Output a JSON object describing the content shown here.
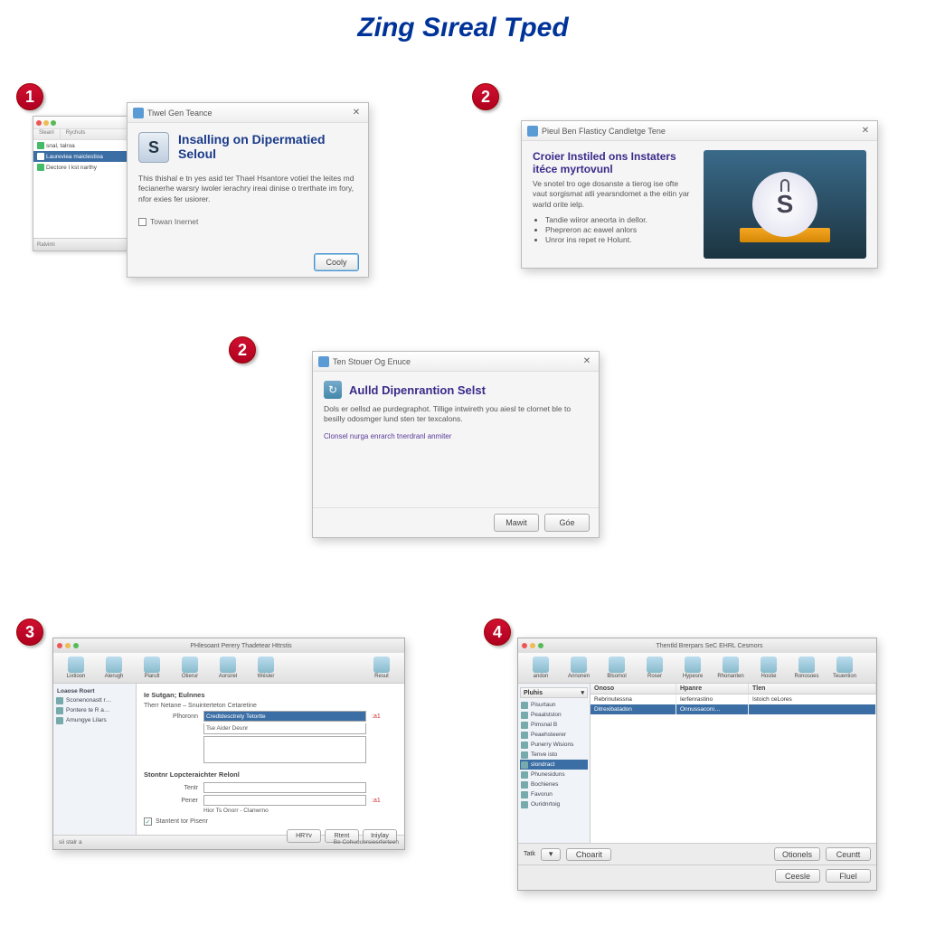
{
  "page": {
    "title": "Zing Sıreal Tped"
  },
  "steps": {
    "s1": "1",
    "s2a": "2",
    "s2b": "2",
    "s3": "3",
    "s4": "4"
  },
  "dlg1": {
    "titlebar": "Tiwel Gen Teance",
    "icon_letter": "S",
    "heading": "Insalling on Dipermatied Seloul",
    "body": "This thishal e tn yes asid ter Thael Hsantore votiel the leites md fecianerhe warsry iwoler ierachry ireai dinise o trerthate im fory, nfor exies fer usiorer.",
    "checkbox": "Towan Inernet",
    "btn_primary": "Cooly",
    "mini": {
      "row_hl": "Laureviea maiclestioa",
      "row2": "Dectore l kst narthy"
    }
  },
  "dlg2a": {
    "titlebar": "Pieul Ben Flasticy Candletge Tene",
    "heading": "Croier Instiled ons Instaters itéce myrtovunl",
    "body": "Ve snotel tro oge dosanste a tierog ise ofte vaut sorgismat atli yearsndomet a the eitin yar warld orite ielp.",
    "bullets": [
      "Tandie wiiror aneorta in dellor.",
      "Phepreron ac eawel anlors",
      "Unror ins repet re Holunt."
    ],
    "badge_letter": "S"
  },
  "dlg2b": {
    "titlebar": "Ten Stouer Og Enuce",
    "heading": "Aulld Dipenrantion Selst",
    "body": "Dols er oellsd ae purdegraphot. Tillige intwireth you aiesl te clornet ble to besilly odosmger lund sten ter texcalons.",
    "link": "Clonsel nurga enrarch tnerdranl anmiter",
    "btn1": "Mawit",
    "btn2": "Góe"
  },
  "win3": {
    "title": "PHlesoant Perery Thadetear Httrstis",
    "toolbar": [
      "Lixtioon",
      "Alerugh",
      "Plarutl",
      "Otierur",
      "Aorsirel",
      "Wésler",
      "Resut"
    ],
    "sidebar": {
      "header": "Loaose Roert",
      "items": [
        "Sconenonastt r…",
        "Pontere te R a…",
        "Amungye Lilars"
      ]
    },
    "pane": {
      "section1": "Ie Sutgan; Eulnnes",
      "label_row": "Therr  Netane – Snuinterteton Cetaretine",
      "field1_label": "Plhoronn",
      "field1_value": "Credtdesctrety Tetortte",
      "field1_sub": "Tse Aider Deunr",
      "badge1": ":a1",
      "section2": "Stontnr Lopcteraichter Relonl",
      "field2_label": "Tentr",
      "field3_label": "Pener",
      "row_caption": "Hior  Ts Onorr - Clanwrno",
      "badge2": ":a1",
      "checkbox": "Stantent tor Pisenr",
      "btns": [
        "HRYv",
        "Rtent",
        "Iniylay"
      ]
    },
    "status_left": "sii stalr a",
    "status_right": "Be Cohuouersiesrferteen"
  },
  "win4": {
    "title": "Thentld Brerpars SeC EHRL Cesmors",
    "toolbar": [
      "andon",
      "Annonen",
      "Blsomol",
      "Roser",
      "Hypesre",
      "Rhonanten",
      "Hostie",
      "Ronosoes",
      "Teuention"
    ],
    "leftpanel": {
      "header": "Pluhis",
      "items": [
        "Pisurtaun",
        "Peaalstslon",
        "Pimsnal B",
        "Peaehsteerer",
        "Punerry Wisions",
        "Tenve isto",
        "slondract",
        "Phunesiduns",
        "Bochienes",
        "Favorun",
        "Ouridnrtoig"
      ],
      "hl_index": 6
    },
    "columns": [
      "Onoso",
      "Hpanre",
      "Tlen"
    ],
    "rows": [
      [
        "Rebrinutessna",
        "Ierfenrastino",
        "Istoich ceLores"
      ],
      [
        "Ditrexibatadon",
        "Onnussaconi…",
        ""
      ]
    ],
    "row_hl_index": 1,
    "bottom": {
      "label": "Tatk",
      "btn1": "Choarit",
      "btn_r1": "Otionels",
      "btn_r2": "Ceuntt",
      "btn_r3": "Ceesle",
      "btn_r4": "Fluel"
    }
  }
}
